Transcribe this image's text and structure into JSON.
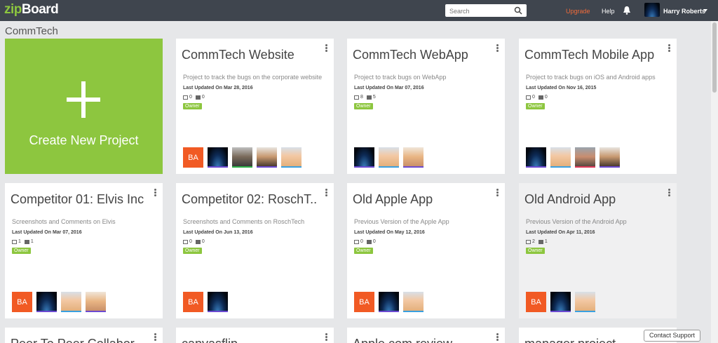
{
  "app": {
    "logo_prefix": "zip",
    "logo_suffix": "Board"
  },
  "search": {
    "placeholder": "Search"
  },
  "nav": {
    "upgrade": "Upgrade",
    "help": "Help",
    "user_name": "Harry Roberts"
  },
  "page": {
    "title": "CommTech"
  },
  "create": {
    "label": "Create New Project"
  },
  "projects": [
    {
      "title": "CommTech Website",
      "desc": "Project to track the bugs on the corporate website",
      "updated": "Last Updated On Mar 28, 2016",
      "images": "0",
      "comments": "0",
      "role": "Owner"
    },
    {
      "title": "CommTech WebApp",
      "desc": "Project to track bugs on WebApp",
      "updated": "Last Updated On Mar 07, 2016",
      "images": "8",
      "comments": "5",
      "role": "Owner"
    },
    {
      "title": "CommTech Mobile App",
      "desc": "Project to track bugs on iOS and Android apps",
      "updated": "Last Updated On Nov 16, 2015",
      "images": "0",
      "comments": "0",
      "role": "Owner"
    },
    {
      "title": "Competitor 01: Elvis Inc",
      "desc": "Screenshots and Comments on Elvis",
      "updated": "Last Updated On Mar 07, 2016",
      "images": "1",
      "comments": "1",
      "role": "Owner"
    },
    {
      "title": "Competitor 02: RoschT..",
      "desc": "Screenshots and Comments on RoschTech",
      "updated": "Last Updated On Jun 13, 2016",
      "images": "0",
      "comments": "0",
      "role": "Owner"
    },
    {
      "title": "Old Apple App",
      "desc": "Previous Version of the Apple App",
      "updated": "Last Updated On May 12, 2016",
      "images": "0",
      "comments": "0",
      "role": "Owner"
    },
    {
      "title": "Old Android App",
      "desc": "Previous Version of the Android App",
      "updated": "Last Updated On Apr 11, 2016",
      "images": "2",
      "comments": "1",
      "role": "Owner"
    },
    {
      "title": "Peer To Peer Collabor..",
      "desc": "",
      "updated": "",
      "images": "",
      "comments": "",
      "role": ""
    },
    {
      "title": "canvasflip",
      "desc": "",
      "updated": "",
      "images": "",
      "comments": "",
      "role": ""
    },
    {
      "title": "Apple.com review",
      "desc": "",
      "updated": "",
      "images": "",
      "comments": "",
      "role": ""
    },
    {
      "title": "manager project",
      "desc": "",
      "updated": "",
      "images": "",
      "comments": "",
      "role": ""
    }
  ],
  "avatar_initials": "BA",
  "contact": {
    "label": "Contact Support"
  },
  "colors": {
    "brand_green": "#8dc63f",
    "topbar": "#3f454e",
    "upgrade": "#f26b3a",
    "initials_bg": "#f15a24"
  }
}
